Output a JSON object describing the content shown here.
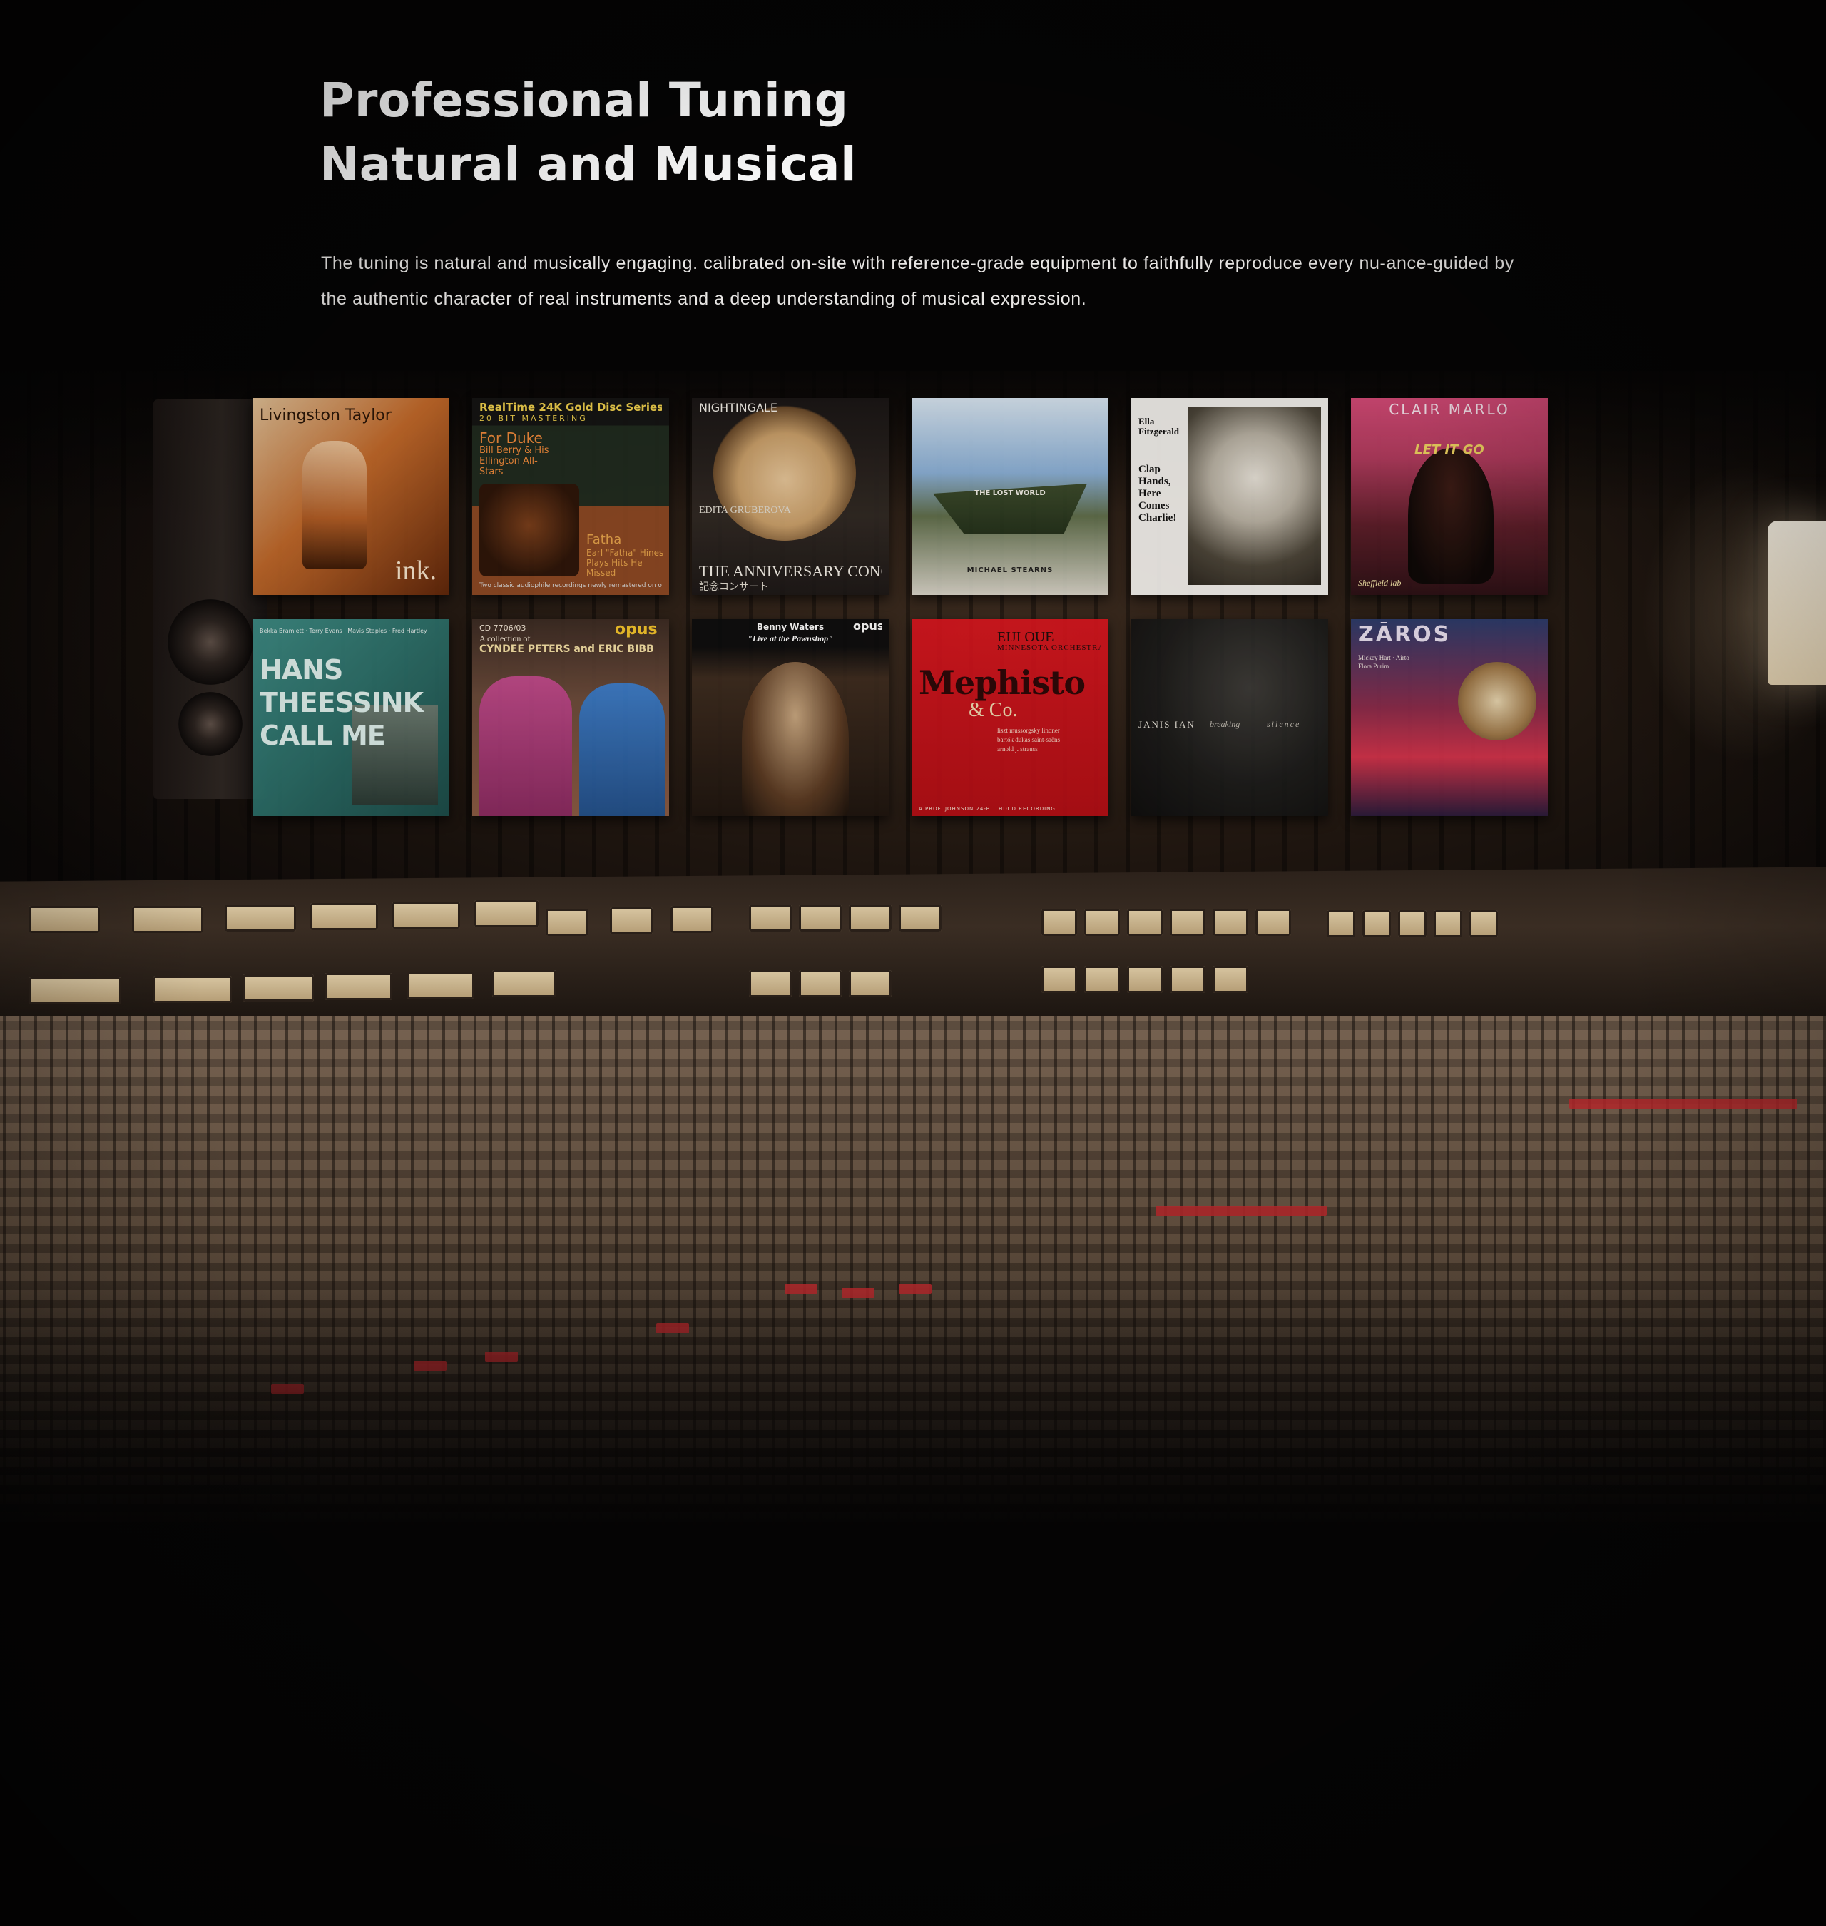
{
  "headline": {
    "line1": "Professional Tuning",
    "line2": "Natural and Musical"
  },
  "description": "The tuning is natural and musically engaging. calibrated on-site with reference-grade equipment to faithfully reproduce every nu-ance-guided by the authentic character of real instruments and a deep understanding of musical expression.",
  "albums": [
    {
      "texts": [
        "Livingston Taylor",
        "ink."
      ]
    },
    {
      "texts": [
        "RealTime 24K Gold Disc Series",
        "20 BIT MASTERING",
        "For Duke",
        "Bill Berry & His Ellington All-Stars",
        "Fatha",
        "Earl \"Fatha\" Hines Plays Hits He Missed",
        "Two classic audiophile recordings newly remastered on one CD!"
      ]
    },
    {
      "texts": [
        "NIGHTINGALE",
        "EDITA GRUBEROVA",
        "THE ANNIVERSARY CONCERT",
        "記念コンサート"
      ]
    },
    {
      "texts": [
        "THE LOST WORLD",
        "MICHAEL STEARNS"
      ]
    },
    {
      "texts": [
        "Ella Fitzgerald",
        "Clap Hands, Here Comes Charlie!"
      ]
    },
    {
      "texts": [
        "CLAIR MARLO",
        "LET IT GO",
        "Sheffield lab"
      ]
    },
    {
      "texts": [
        "HANS THEESSINK CALL ME",
        "Bekka Bramlett · Terry Evans · Mavis Staples · Fred Hartley"
      ]
    },
    {
      "texts": [
        "CD 7706/03",
        "A collection of",
        "CYNDEE PETERS and ERIC BIBB",
        "opus"
      ]
    },
    {
      "texts": [
        "Benny Waters",
        "\"Live at the Pawnshop\"",
        "opus"
      ]
    },
    {
      "texts": [
        "EIJI OUE",
        "MINNESOTA ORCHESTRA",
        "Mephisto",
        "& Co.",
        "liszt mussorgsky lindner bartók dukas saint-saëns arnold j. strauss",
        "A PROF. JOHNSON 24-BIT HDCD RECORDING"
      ]
    },
    {
      "texts": [
        "JANIS IAN",
        "breaking",
        "silence"
      ]
    },
    {
      "texts": [
        "ZĀROS",
        "Mickey Hart · Airto · Flora Purim"
      ]
    }
  ]
}
